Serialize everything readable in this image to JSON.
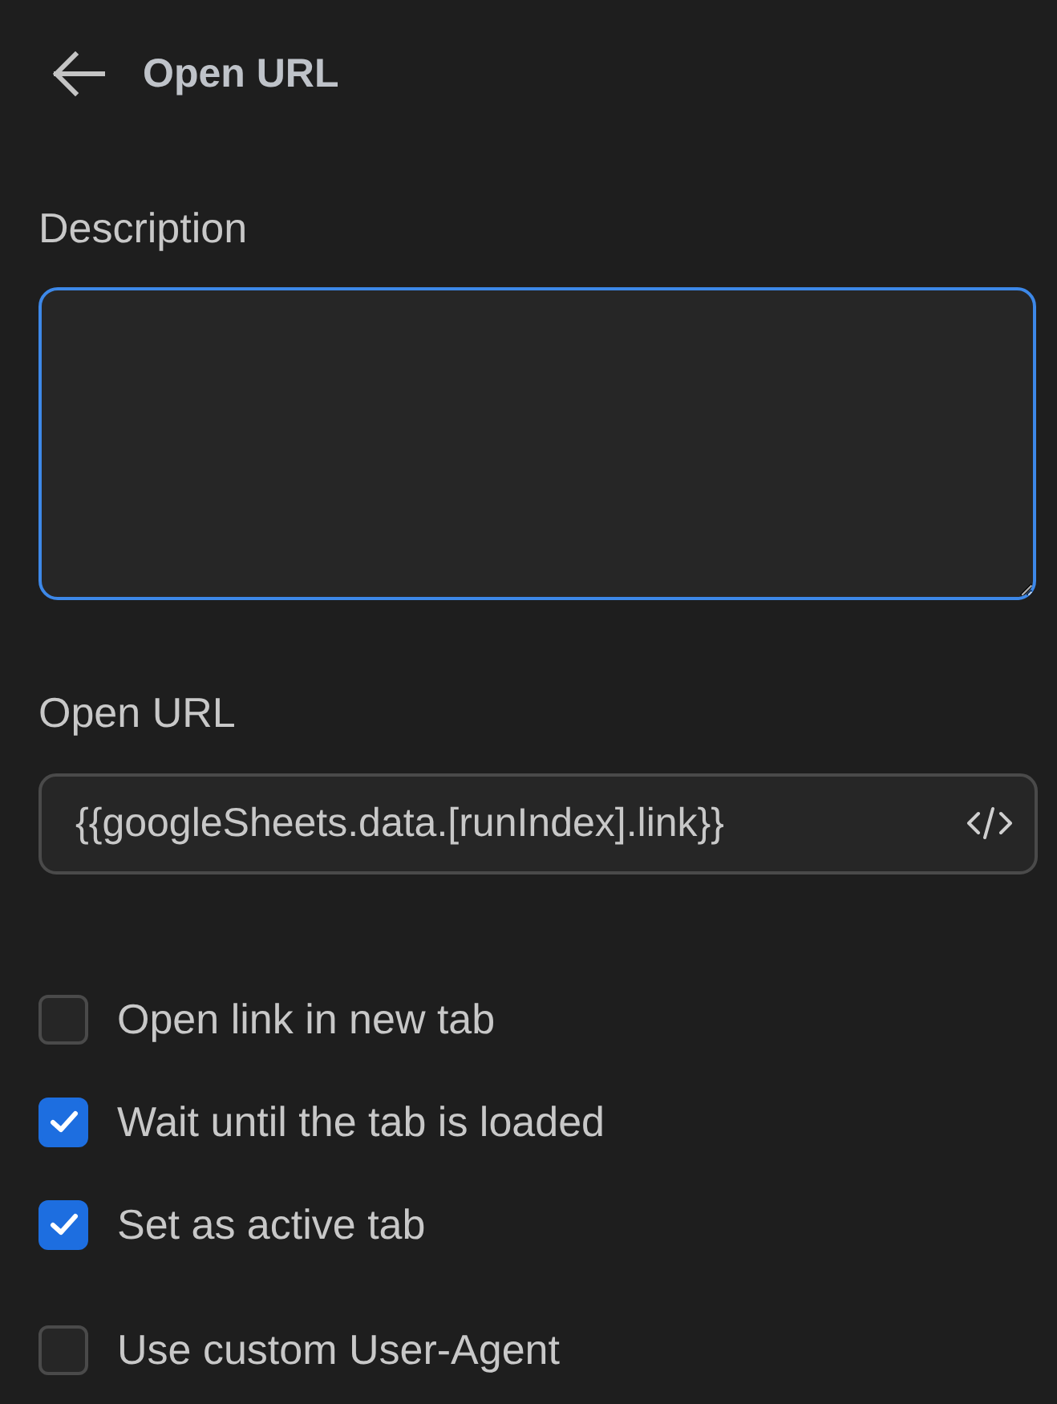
{
  "header": {
    "title": "Open URL"
  },
  "description": {
    "label": "Description",
    "focused": true
  },
  "url": {
    "label": "Open URL",
    "value": "{{googleSheets.data.[runIndex].link}}"
  },
  "tab_options": [
    {
      "label": "Open link in new tab",
      "checked": false
    },
    {
      "label": "Wait until the tab is loaded",
      "checked": true
    },
    {
      "label": "Set as active tab",
      "checked": true
    }
  ],
  "user_agent": {
    "label": "Use custom User-Agent",
    "checked": false
  }
}
